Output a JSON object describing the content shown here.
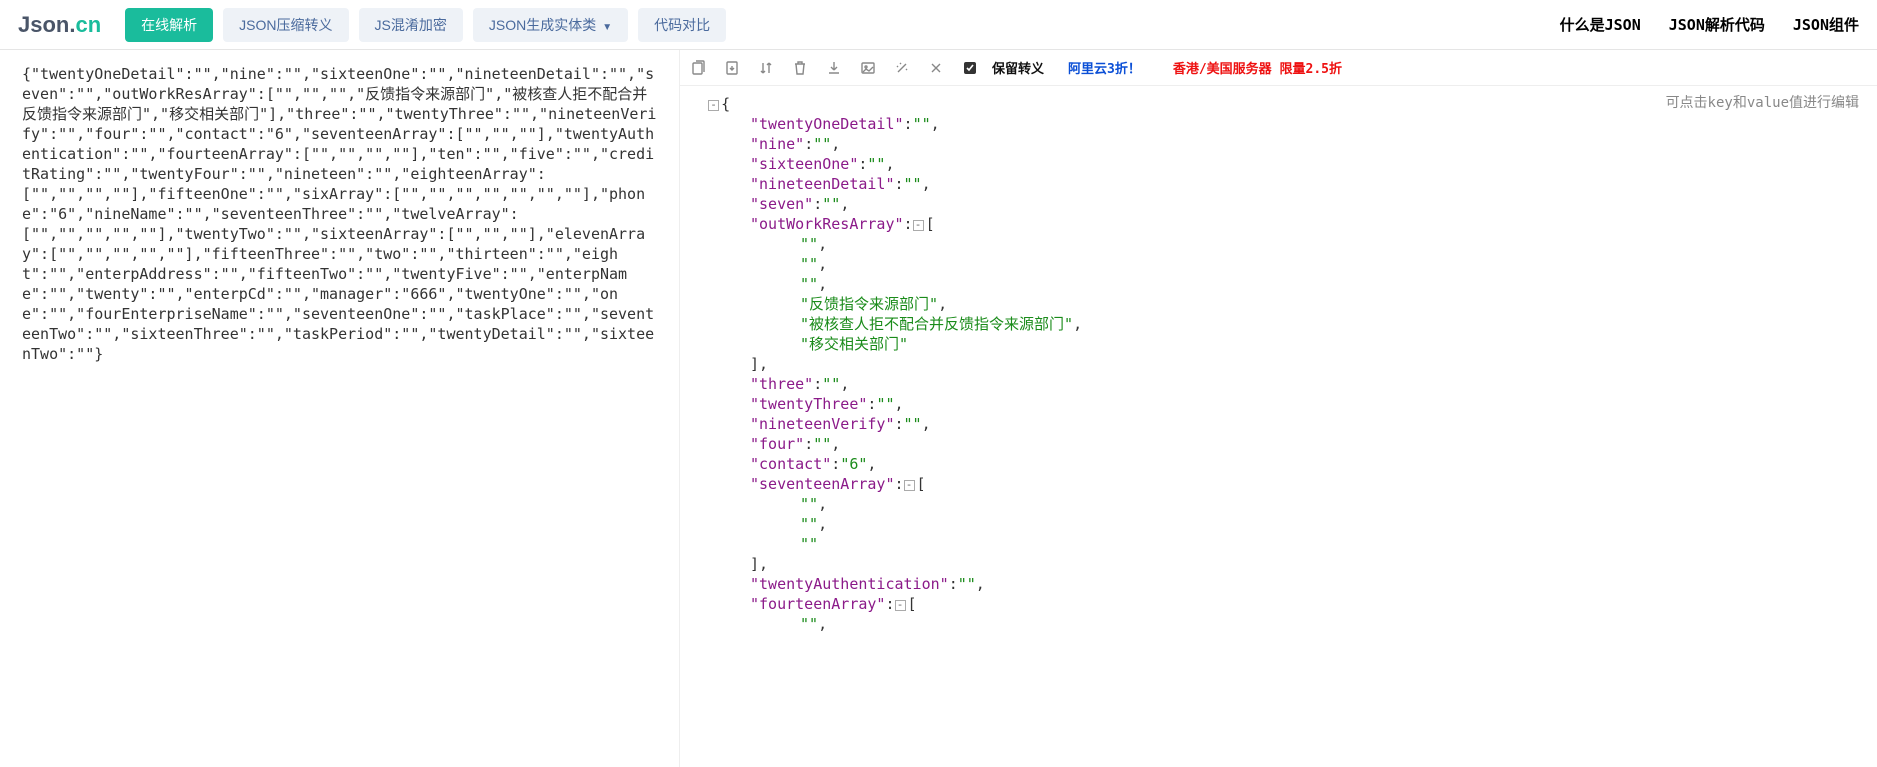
{
  "logo": {
    "part1": "Json",
    "dot": ".",
    "part2": "cn"
  },
  "nav": {
    "parse_online": "在线解析",
    "compress": "JSON压缩转义",
    "jsobfus": "JS混淆加密",
    "gen_entity": "JSON生成实体类",
    "diff": "代码对比"
  },
  "right_links": {
    "what": "什么是JSON",
    "parse_code": "JSON解析代码",
    "widget": "JSON组件"
  },
  "raw_input": "{\"twentyOneDetail\":\"\",\"nine\":\"\",\"sixteenOne\":\"\",\"nineteenDetail\":\"\",\"seven\":\"\",\"outWorkResArray\":[\"\",\"\",\"\",\"反馈指令来源部门\",\"被核查人拒不配合并反馈指令来源部门\",\"移交相关部门\"],\"three\":\"\",\"twentyThree\":\"\",\"nineteenVerify\":\"\",\"four\":\"\",\"contact\":\"6\",\"seventeenArray\":[\"\",\"\",\"\"],\"twentyAuthentication\":\"\",\"fourteenArray\":[\"\",\"\",\"\",\"\"],\"ten\":\"\",\"five\":\"\",\"creditRating\":\"\",\"twentyFour\":\"\",\"nineteen\":\"\",\"eighteenArray\":[\"\",\"\",\"\",\"\"],\"fifteenOne\":\"\",\"sixArray\":[\"\",\"\",\"\",\"\",\"\",\"\",\"\"],\"phone\":\"6\",\"nineName\":\"\",\"seventeenThree\":\"\",\"twelveArray\":[\"\",\"\",\"\",\"\",\"\"],\"twentyTwo\":\"\",\"sixteenArray\":[\"\",\"\",\"\"],\"elevenArray\":[\"\",\"\",\"\",\"\",\"\"],\"fifteenThree\":\"\",\"two\":\"\",\"thirteen\":\"\",\"eight\":\"\",\"enterpAddress\":\"\",\"fifteenTwo\":\"\",\"twentyFive\":\"\",\"enterpName\":\"\",\"twenty\":\"\",\"enterpCd\":\"\",\"manager\":\"666\",\"twentyOne\":\"\",\"one\":\"\",\"fourEnterpriseName\":\"\",\"seventeenOne\":\"\",\"taskPlace\":\"\",\"seventeenTwo\":\"\",\"sixteenThree\":\"\",\"taskPeriod\":\"\",\"twentyDetail\":\"\",\"sixteenTwo\":\"\"}",
  "toolbar": {
    "keep_escape_label": "保留转义",
    "promo1": "阿里云3折！",
    "promo2": "香港/美国服务器 限量2.5折"
  },
  "hint": "可点击key和value值进行编辑",
  "tree_entries": [
    {
      "type": "kv",
      "key": "twentyOneDetail",
      "val": ""
    },
    {
      "type": "kv",
      "key": "nine",
      "val": ""
    },
    {
      "type": "kv",
      "key": "sixteenOne",
      "val": ""
    },
    {
      "type": "kv",
      "key": "nineteenDetail",
      "val": ""
    },
    {
      "type": "kv",
      "key": "seven",
      "val": ""
    },
    {
      "type": "arr_open",
      "key": "outWorkResArray"
    },
    {
      "type": "arr_item",
      "val": ""
    },
    {
      "type": "arr_item",
      "val": ""
    },
    {
      "type": "arr_item",
      "val": ""
    },
    {
      "type": "arr_item",
      "val": "反馈指令来源部门"
    },
    {
      "type": "arr_item",
      "val": "被核查人拒不配合并反馈指令来源部门"
    },
    {
      "type": "arr_item",
      "val": "移交相关部门",
      "last": true
    },
    {
      "type": "arr_close"
    },
    {
      "type": "kv",
      "key": "three",
      "val": ""
    },
    {
      "type": "kv",
      "key": "twentyThree",
      "val": ""
    },
    {
      "type": "kv",
      "key": "nineteenVerify",
      "val": ""
    },
    {
      "type": "kv",
      "key": "four",
      "val": ""
    },
    {
      "type": "kv",
      "key": "contact",
      "val": "6"
    },
    {
      "type": "arr_open",
      "key": "seventeenArray"
    },
    {
      "type": "arr_item",
      "val": ""
    },
    {
      "type": "arr_item",
      "val": ""
    },
    {
      "type": "arr_item",
      "val": "",
      "last": true
    },
    {
      "type": "arr_close"
    },
    {
      "type": "kv",
      "key": "twentyAuthentication",
      "val": ""
    },
    {
      "type": "arr_open",
      "key": "fourteenArray"
    },
    {
      "type": "arr_item",
      "val": ""
    }
  ]
}
